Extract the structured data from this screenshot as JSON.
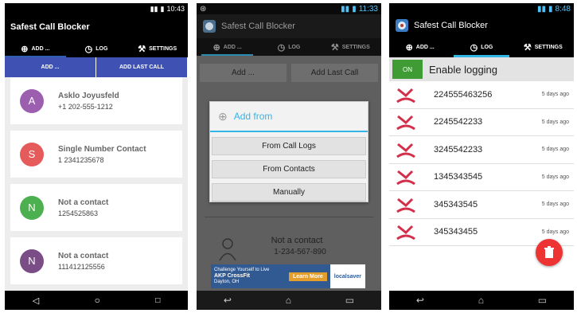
{
  "phone1": {
    "status_time": "10:43",
    "title": "Safest Call Blocker",
    "tabs": [
      "ADD ...",
      "LOG",
      "SETTINGS"
    ],
    "buttons": [
      "ADD ...",
      "ADD LAST CALL"
    ],
    "contacts": [
      {
        "initial": "A",
        "name": "Asklo Joyusfeld",
        "number": "+1 202-555-1212",
        "color": "#9c5fb0"
      },
      {
        "initial": "S",
        "name": "Single Number Contact",
        "number": "1 2341235678",
        "color": "#e55a5a"
      },
      {
        "initial": "N",
        "name": "Not a contact",
        "number": "1254525863",
        "color": "#4caf50"
      },
      {
        "initial": "N",
        "name": "Not a contact",
        "number": "111412125556",
        "color": "#7b4d86"
      }
    ]
  },
  "phone2": {
    "status_time": "11:33",
    "title": "Safest Call Blocker",
    "tabs": [
      "ADD ...",
      "LOG",
      "SETTINGS"
    ],
    "buttons": [
      "Add ...",
      "Add Last Call"
    ],
    "dialog": {
      "title": "Add from",
      "options": [
        "From Call Logs",
        "From Contacts",
        "Manually"
      ]
    },
    "contact": {
      "name": "Not a contact",
      "number": "1-234-567-890"
    },
    "ad": {
      "line1": "Challenge Yourself to Live",
      "line2": "AKP CrossFit",
      "line3": "Dayton, OH",
      "button": "Learn More",
      "brand": "localsaver"
    }
  },
  "phone3": {
    "status_time": "8:48",
    "title": "Safest Call Blocker",
    "tabs": [
      "ADD ...",
      "LOG",
      "SETTINGS"
    ],
    "logging": {
      "switch": "ON",
      "label": "Enable logging"
    },
    "log": [
      {
        "number": "224555463256",
        "ago": "5 days ago"
      },
      {
        "number": "2245542233",
        "ago": "5 days ago"
      },
      {
        "number": "3245542233",
        "ago": "5 days ago"
      },
      {
        "number": "1345343545",
        "ago": "5 days ago"
      },
      {
        "number": "345343545",
        "ago": "5 days ago"
      },
      {
        "number": "345343455",
        "ago": "5 days ago"
      }
    ]
  }
}
